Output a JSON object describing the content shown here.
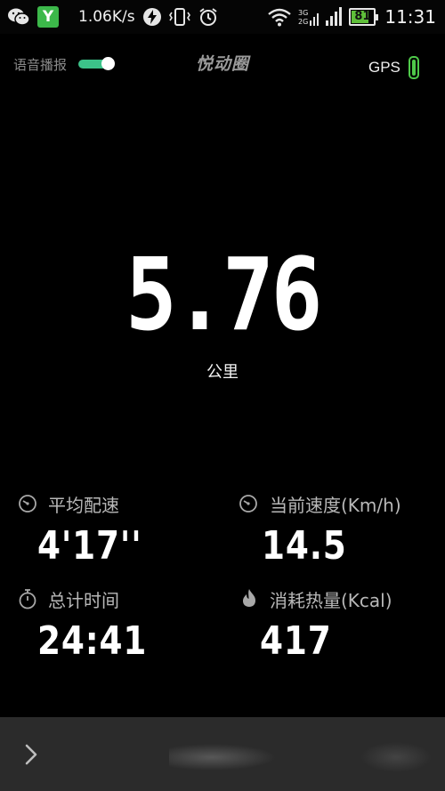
{
  "status_bar": {
    "net_speed": "1.06K/s",
    "network_labels": [
      "3G",
      "2G"
    ],
    "battery_level": "81",
    "battery_fraction": 0.81,
    "time": "11:31",
    "icons": [
      "wechat-icon",
      "y-app-icon",
      "lightning-icon",
      "vibrate-icon",
      "alarm-icon",
      "wifi-icon",
      "cellular-signal-icon",
      "battery-icon"
    ]
  },
  "header": {
    "voice_broadcast_label": "语音播报",
    "voice_broadcast_on": true,
    "brand": "悦动圈",
    "gps_label": "GPS",
    "gps_status_color": "#4fc94a"
  },
  "distance": {
    "value": "5.76",
    "unit": "公里"
  },
  "stats": {
    "avg_pace": {
      "label": "平均配速",
      "value": "4'17''",
      "icon": "speedometer-icon"
    },
    "current_speed": {
      "label": "当前速度(Km/h)",
      "value": "14.5",
      "icon": "speedometer-icon"
    },
    "total_time": {
      "label": "总计时间",
      "value": "24:41",
      "icon": "stopwatch-icon"
    },
    "calories": {
      "label": "消耗热量(Kcal)",
      "value": "417",
      "icon": "flame-icon"
    }
  },
  "bottom_bar": {
    "expand_icon": "chevron-right-icon"
  },
  "colors": {
    "background": "#000000",
    "accent_toggle": "#3cc289",
    "bottom_bar": "#2b2b2b"
  }
}
